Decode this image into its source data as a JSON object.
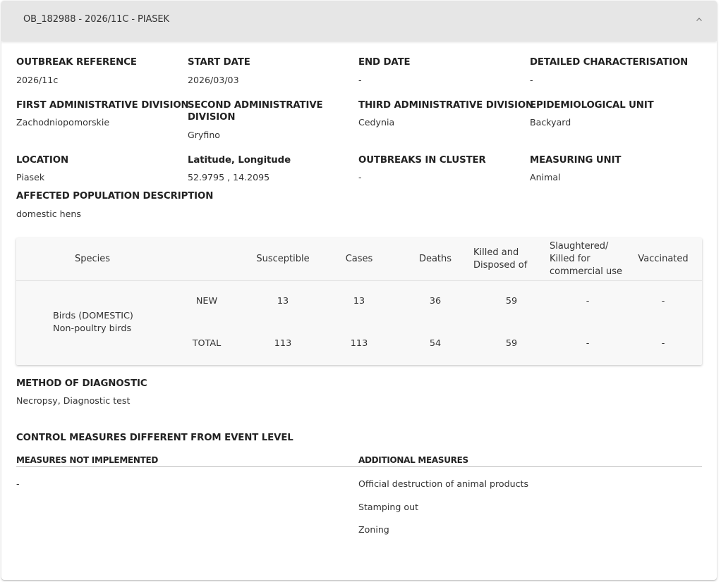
{
  "panel": {
    "title": "OB_182988 - 2026/11C - PIASEK"
  },
  "fields": {
    "outbreak_reference": {
      "label": "OUTBREAK REFERENCE",
      "value": "2026/11c"
    },
    "start_date": {
      "label": "START DATE",
      "value": "2026/03/03"
    },
    "end_date": {
      "label": "END DATE",
      "value": "-"
    },
    "detailed_characterisation": {
      "label": "DETAILED CHARACTERISATION",
      "value": "-"
    },
    "first_admin_division": {
      "label": "FIRST ADMINISTRATIVE DIVISION",
      "value": "Zachodniopomorskie"
    },
    "second_admin_division": {
      "label_line1": "SECOND ADMINISTRATIVE",
      "label_line2": "DIVISION",
      "value": "Gryfino"
    },
    "third_admin_division": {
      "label": "THIRD ADMINISTRATIVE DIVISION",
      "value": "Cedynia"
    },
    "epidemiological_unit": {
      "label": "EPIDEMIOLOGICAL UNIT",
      "value": "Backyard"
    },
    "location": {
      "label": "LOCATION",
      "value": "Piasek"
    },
    "lat_long": {
      "label": "Latitude, Longitude",
      "value": "52.9795 , 14.2095"
    },
    "outbreaks_in_cluster": {
      "label": "OUTBREAKS IN CLUSTER",
      "value": "-"
    },
    "measuring_unit": {
      "label": "MEASURING UNIT",
      "value": "Animal"
    },
    "affected_population": {
      "label": "AFFECTED POPULATION DESCRIPTION",
      "value": "domestic hens"
    }
  },
  "table": {
    "headers": {
      "species": "Species",
      "susceptible": "Susceptible",
      "cases": "Cases",
      "deaths": "Deaths",
      "killed_line1": "Killed and",
      "killed_line2": "Disposed of",
      "slaughtered_line1": "Slaughtered/",
      "slaughtered_line2": "Killed for",
      "slaughtered_line3": "commercial use",
      "vaccinated": "Vaccinated"
    },
    "species_line1": "Birds (DOMESTIC)",
    "species_line2": "Non-poultry birds",
    "rows": [
      {
        "type": "NEW",
        "susceptible": "13",
        "cases": "13",
        "deaths": "36",
        "killed": "59",
        "slaughtered": "-",
        "vaccinated": "-"
      },
      {
        "type": "TOTAL",
        "susceptible": "113",
        "cases": "113",
        "deaths": "54",
        "killed": "59",
        "slaughtered": "-",
        "vaccinated": "-"
      }
    ]
  },
  "diagnostic": {
    "label": "METHOD OF DIAGNOSTIC",
    "value": "Necropsy, Diagnostic test"
  },
  "control_measures": {
    "title": "CONTROL MEASURES DIFFERENT FROM EVENT LEVEL",
    "not_implemented_header": "MEASURES NOT IMPLEMENTED",
    "additional_header": "ADDITIONAL MEASURES",
    "not_implemented": [
      "-"
    ],
    "additional": [
      "Official destruction of animal products",
      "Stamping out",
      "Zoning"
    ]
  },
  "icons": {
    "collapse": "chevron-up-icon"
  }
}
